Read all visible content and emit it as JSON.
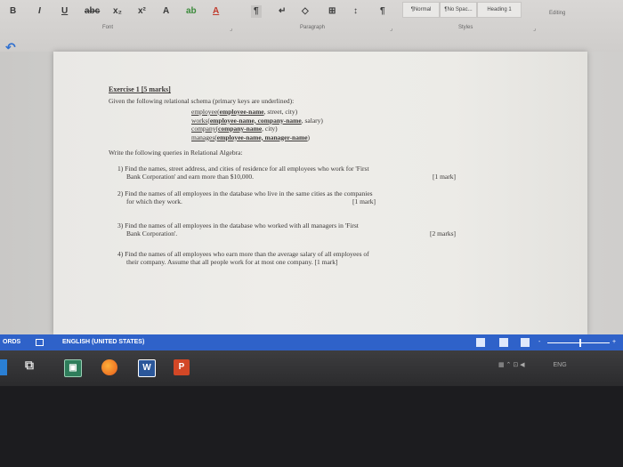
{
  "ribbon": {
    "buttons": [
      "B",
      "I",
      "U",
      "abc",
      "x₂",
      "x²",
      "A",
      "ab",
      "A",
      "¶",
      "↵",
      "◇",
      "⊞",
      "↕",
      "¶"
    ],
    "styles": [
      "¶Normal",
      "¶No Spac...",
      "Heading 1"
    ],
    "groups": {
      "font": "Font",
      "paragraph": "Paragraph",
      "styles": "Styles",
      "editing": "Editing"
    }
  },
  "document": {
    "title": "Exercise 1 [5 marks]",
    "intro": "Given the following relational schema (primary keys are underlined):",
    "schema": [
      {
        "rel": "employee",
        "keys": "employee-name",
        "rest": ", street, city)"
      },
      {
        "rel": "works",
        "keys": "employee-name, company-name",
        "rest": ", salary)"
      },
      {
        "rel": "company",
        "keys": "company-name",
        "rest": ", city)"
      },
      {
        "rel": "manages",
        "keys": "employee-name, manager-name",
        "rest": ")"
      }
    ],
    "instruction": "Write the following queries in Relational Algebra:",
    "questions": [
      {
        "num": "1)",
        "line1": "Find the names, street address, and cities of residence for all employees who work for 'First",
        "line2": "Bank Corporation' and earn more than $10,000.",
        "mark": "[1 mark]"
      },
      {
        "num": "2)",
        "line1": "Find the names of all employees in the database who live in the same cities as the companies",
        "line2": "for which they work.",
        "mark": "[1 mark]"
      },
      {
        "num": "3)",
        "line1": "Find the names of all employees in the database who worked with all managers in 'First",
        "line2": "Bank Corporation'.",
        "mark": "[2 marks]"
      },
      {
        "num": "4)",
        "line1": "Find the names of all employees who earn more than the average salary of all employees of",
        "line2": "their company. Assume that all people work for at most one company.",
        "mark": "[1 mark]"
      }
    ]
  },
  "statusbar": {
    "left": "ORDS",
    "language": "ENGLISH (UNITED STATES)",
    "zoom_minus": "-",
    "zoom_plus": "+"
  },
  "taskbar": {
    "word_label": "W",
    "ppt_label": "P",
    "tray_lang": "ENG"
  },
  "colors": {
    "statusbar": "#2f62c9",
    "word": "#2b579a",
    "ppt": "#d24726"
  }
}
